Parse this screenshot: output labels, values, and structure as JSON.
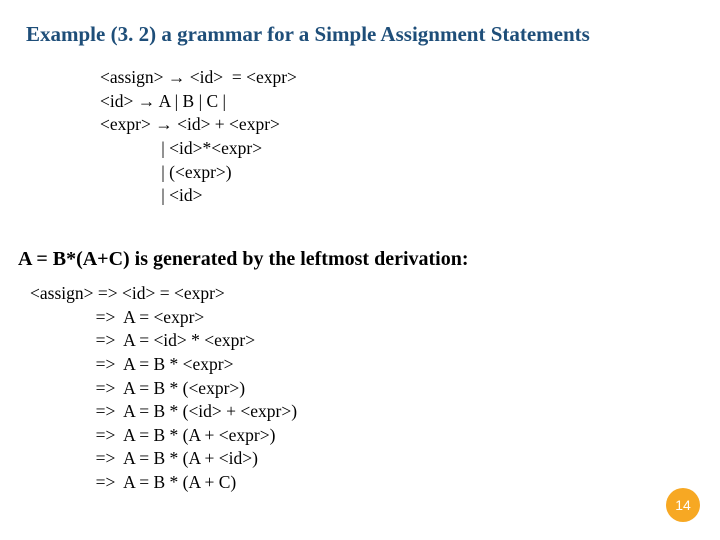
{
  "title": "Example (3. 2) a grammar for a Simple Assignment Statements",
  "grammar": "<assign> → <id>  = <expr>\n<id> → A | B | C |\n<expr> → <id> + <expr>\n              | <id>*<expr>\n              | (<expr>)\n              | <id>",
  "caption": "A = B*(A+C) is generated by the leftmost derivation:",
  "derivation": "<assign> => <id> = <expr>\n               =>  A = <expr>\n               =>  A = <id> * <expr>\n               =>  A = B * <expr>\n               =>  A = B * (<expr>)\n               =>  A = B * (<id> + <expr>)\n               =>  A = B * (A + <expr>)\n               =>  A = B * (A + <id>)\n               =>  A = B * (A + C)",
  "page_number": "14"
}
